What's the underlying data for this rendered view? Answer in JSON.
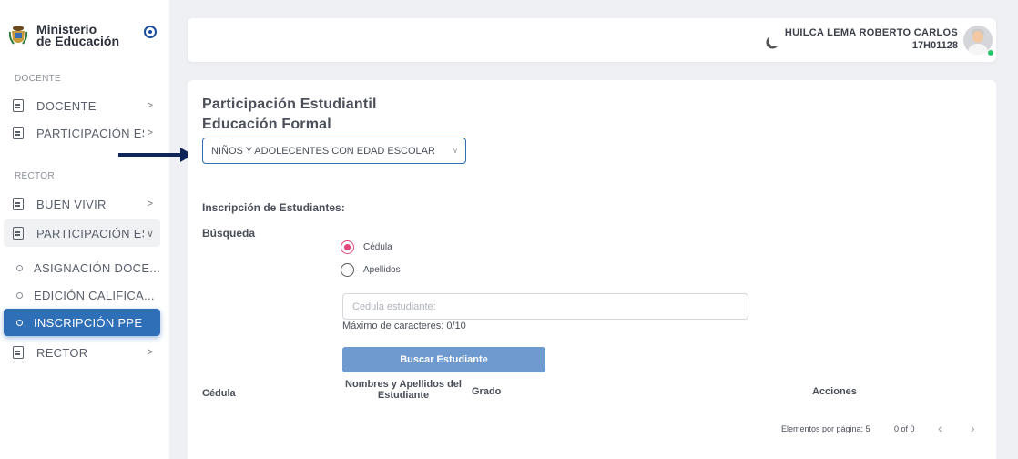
{
  "sidebar": {
    "brand_line1": "Ministerio",
    "brand_line2": "de Educación",
    "section_docente": "DOCENTE",
    "docente_items": [
      {
        "label": "DOCENTE"
      },
      {
        "label": "PARTICIPACIÓN ES..."
      }
    ],
    "section_rector": "RECTOR",
    "rector_items": [
      {
        "label": "BUEN VIVIR"
      },
      {
        "label": "PARTICIPACIÓN ES..."
      }
    ],
    "sub_items": [
      {
        "label": "ASIGNACIÓN DOCE..."
      },
      {
        "label": "EDICIÓN CALIFICA..."
      },
      {
        "label": "INSCRIPCIÓN PPE"
      }
    ],
    "rector_last": {
      "label": "RECTOR"
    }
  },
  "header": {
    "user_name": "HUILCA LEMA ROBERTO CARLOS",
    "user_id": "17H01128"
  },
  "main": {
    "title": "Participación Estudiantil",
    "subtitle": "Educación Formal",
    "select_value": "NIÑOS Y ADOLECENTES CON EDAD ESCOLAR",
    "section_title": "Inscripción de Estudiantes:",
    "search_label": "Búsqueda",
    "radio_options": [
      {
        "label": "Cédula",
        "checked": true
      },
      {
        "label": "Apellidos",
        "checked": false
      }
    ],
    "input_placeholder": "Cedula estudiante:",
    "max_chars": "Máximo de caracteres: 0/10",
    "search_button": "Buscar Estudiante",
    "table_headers": {
      "cedula": "Cédula",
      "nombres_line1": "Nombres y Apellidos del",
      "nombres_line2": "Estudiante",
      "grado": "Grado",
      "acciones": "Acciones"
    },
    "paginator": {
      "items_per_page": "Elementos por página: 5",
      "range": "0 of 0"
    }
  },
  "colors": {
    "primary": "#2f6fb8",
    "radio_accent": "#e0457b",
    "arrow": "#0f2557",
    "button": "#6e9ad0"
  }
}
